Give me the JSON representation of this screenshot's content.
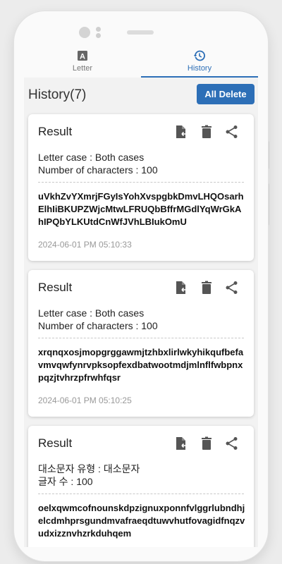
{
  "tabs": [
    {
      "label": "Letter",
      "icon": "letter-a-icon",
      "active": false
    },
    {
      "label": "History",
      "icon": "history-icon",
      "active": true
    }
  ],
  "header": {
    "title": "History(7)",
    "all_delete_label": "All Delete"
  },
  "colors": {
    "accent": "#2d6fb7",
    "icon_gray": "#555555"
  },
  "cards": [
    {
      "title": "Result",
      "meta_line1": "Letter case : Both cases",
      "meta_line2": "Number of characters : 100",
      "generated": "uVkhZvYXmrjFGyIsYohXvspgbkDmvLHQOsarhElhIiBKUPZWjcMtwLFRUQbBffrMGdlYqWrGkAhIPQbYLKUtdCnWfJVhLBIukOmU",
      "timestamp": "2024-06-01 PM 05:10:33"
    },
    {
      "title": "Result",
      "meta_line1": "Letter case : Both cases",
      "meta_line2": "Number of characters : 100",
      "generated": "xrqnqxosjmopgrggawmjtzhbxlirlwkyhikqufbefavmvqwfynrvpksopfexdbatwootmdjmlnflfwbpnxpqzjtvhrzpfrwhfqsr",
      "timestamp": "2024-06-01 PM 05:10:25"
    },
    {
      "title": "Result",
      "meta_line1": "대소문자 유형 : 대소문자",
      "meta_line2": "글자 수 : 100",
      "generated": "oelxqwmcofnounskdpzignuxponnfvlggrlubndhjelcdmhprsgundmvafraeqdtuwvhutfovagidfnqzvudxizznvhzrkduhqem",
      "timestamp": ""
    }
  ]
}
